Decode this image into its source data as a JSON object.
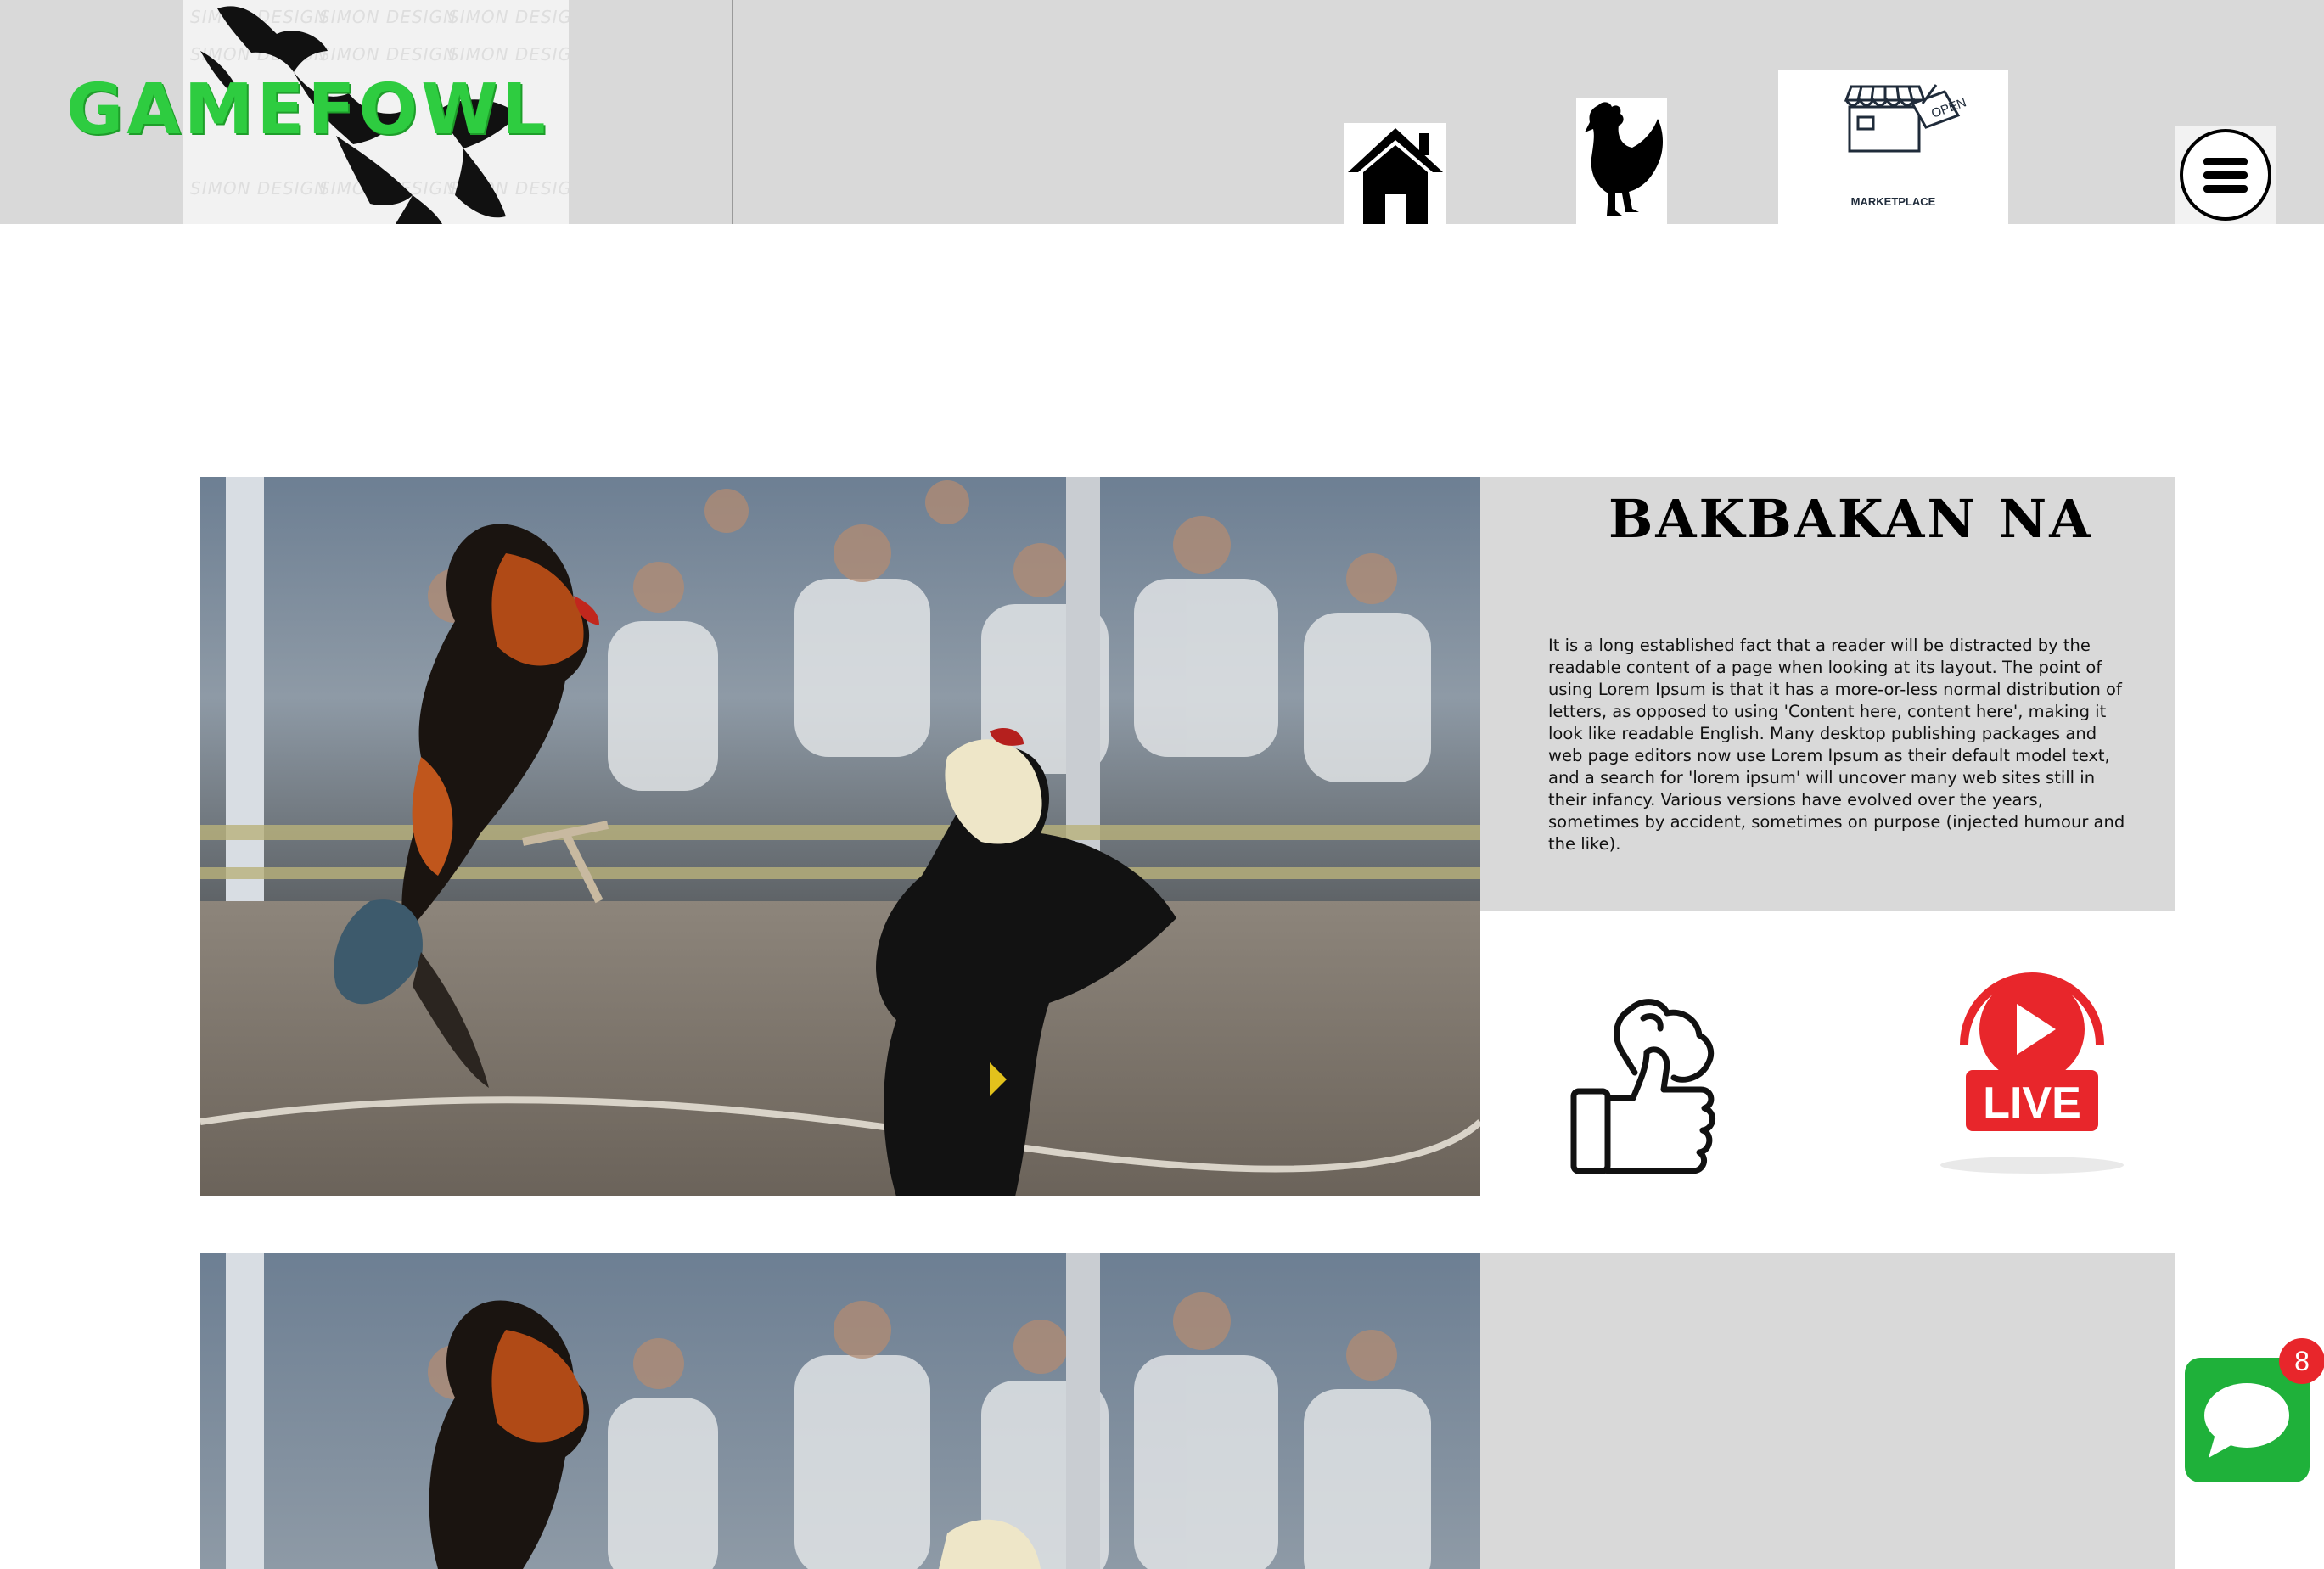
{
  "header": {
    "logo_text": "GAMEFOWL",
    "logo_watermark": "SIMON DESIGN",
    "nav": {
      "home_icon": "home-icon",
      "gamefowl_icon": "rooster-silhouette-icon",
      "marketplace_icon": "open-store-icon",
      "marketplace_label": "MARKETPLACE",
      "menu_icon": "hamburger-menu-icon"
    }
  },
  "feature": {
    "heading": "BAKBAKAN NA",
    "body": "It is a long established fact that a reader will be distracted by the readable content of a page when looking at its layout. The point of using Lorem Ipsum is that it has a more-or-less normal distribution of letters, as opposed to using 'Content here, content here', making it look like readable English. Many desktop publishing packages and web page editors now use Lorem Ipsum as their default model text, and a search for 'lorem ipsum' will uncover many web sites still in their infancy. Various versions have evolved over the years, sometimes by accident, sometimes on purpose (injected humour and the like).",
    "like_icon": "thumbs-up-rooster-icon",
    "live_label": "LIVE",
    "live_icon": "live-play-icon"
  },
  "chat": {
    "icon": "chat-bubble-icon",
    "badge_count": "8"
  },
  "colors": {
    "header_bg": "#d9d9d9",
    "logo_green": "#2ecc40",
    "panel_bg": "#d9d9d9",
    "live_red": "#e8262b",
    "chat_green": "#1fb13a"
  }
}
